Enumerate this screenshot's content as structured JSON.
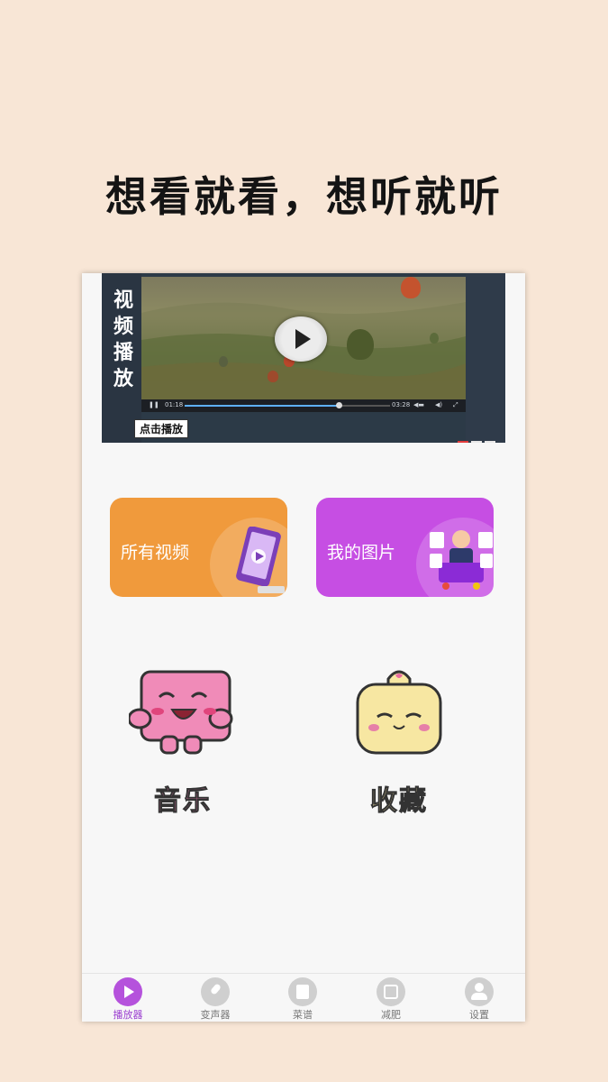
{
  "headline": "想看就看，想听就听",
  "banner": {
    "vertical_title": [
      "视",
      "频",
      "播",
      "放"
    ],
    "time_elapsed": "01:18",
    "time_total": "03:28",
    "progress": 0.75,
    "click_label": "点击播放",
    "indicator_count": 3,
    "active_indicator": 0
  },
  "cards": [
    {
      "label": "所有视频",
      "color": "#f09a3c"
    },
    {
      "label": "我的图片",
      "color": "#c64ee3"
    }
  ],
  "features": [
    {
      "label": "音乐",
      "color": "#f08bb8"
    },
    {
      "label": "收藏",
      "color": "#f7e7a2"
    }
  ],
  "tabs": [
    {
      "label": "播放器",
      "icon": "play-icon",
      "active": true
    },
    {
      "label": "变声器",
      "icon": "microphone-icon",
      "active": false
    },
    {
      "label": "菜谱",
      "icon": "recipe-icon",
      "active": false
    },
    {
      "label": "减肥",
      "icon": "scale-icon",
      "active": false
    },
    {
      "label": "设置",
      "icon": "users-icon",
      "active": false
    }
  ],
  "colors": {
    "background": "#f8e6d6",
    "accent": "#9b3fd0"
  }
}
